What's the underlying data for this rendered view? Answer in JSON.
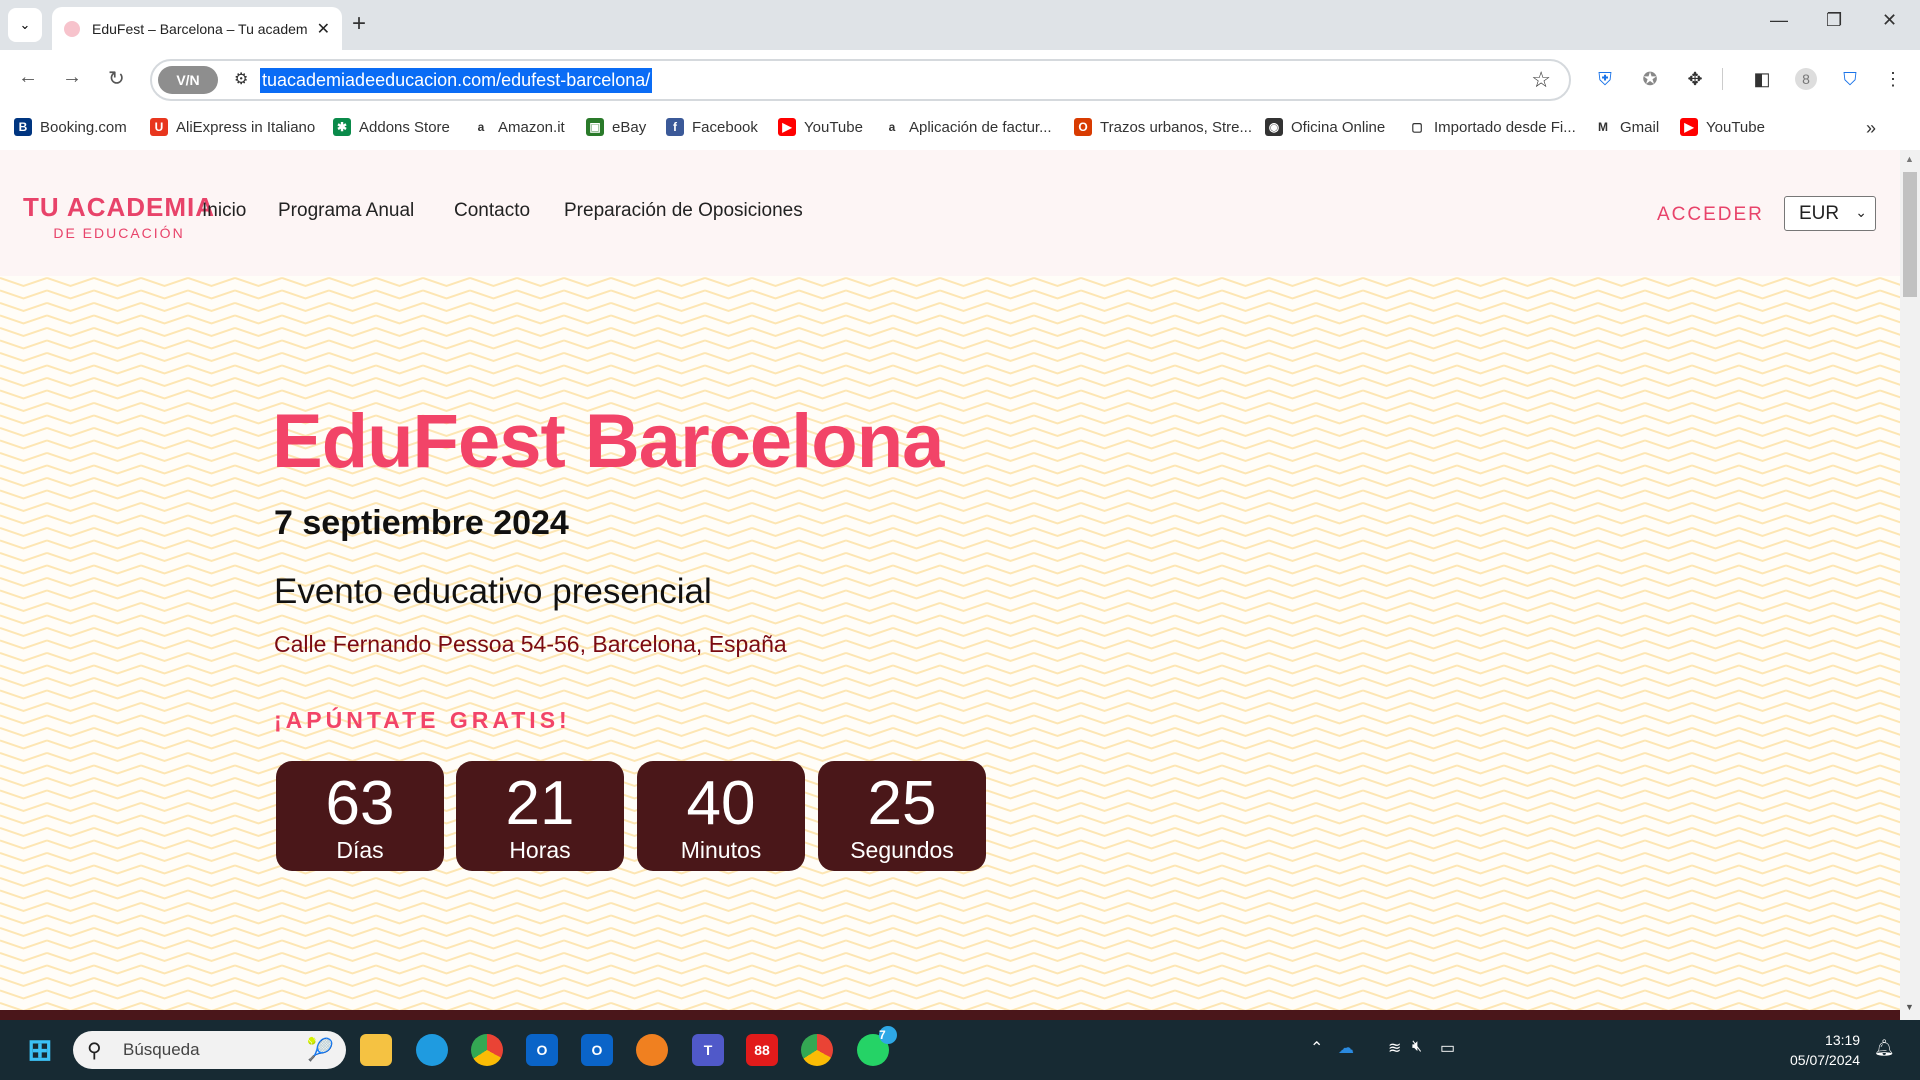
{
  "browser": {
    "tab_title": "EduFest – Barcelona – Tu academia de educación",
    "url": "tuacademiadeeducacion.com/edufest-barcelona/",
    "vpn_label": "V/N",
    "bookmarks": [
      {
        "label": "Booking.com",
        "color": "#003580",
        "glyph": "B"
      },
      {
        "label": "AliExpress in Italiano",
        "color": "#e8361e",
        "glyph": "U"
      },
      {
        "label": "Addons Store",
        "color": "#0a8a4a",
        "glyph": "✱"
      },
      {
        "label": "Amazon.it",
        "color": "#ffffff",
        "glyph": "a"
      },
      {
        "label": "eBay",
        "color": "#2a7a2a",
        "glyph": "▣"
      },
      {
        "label": "Facebook",
        "color": "#3b5998",
        "glyph": "f"
      },
      {
        "label": "YouTube",
        "color": "#ff0000",
        "glyph": "▶"
      },
      {
        "label": "Aplicación de factur...",
        "color": "#ffffff",
        "glyph": "a"
      },
      {
        "label": "Trazos urbanos, Stre...",
        "color": "#d83b01",
        "glyph": "O"
      },
      {
        "label": "Oficina Online",
        "color": "#333333",
        "glyph": "◉"
      },
      {
        "label": "Importado desde Fi...",
        "color": "#ffffff",
        "glyph": "▢"
      },
      {
        "label": "Gmail",
        "color": "#ffffff",
        "glyph": "M"
      },
      {
        "label": "YouTube",
        "color": "#ff0000",
        "glyph": "▶"
      }
    ]
  },
  "site": {
    "logo_line1": "TU ACADEMIA",
    "logo_line2": "DE EDUCACIÓN",
    "nav": [
      "Inicio",
      "Programa Anual",
      "Contacto",
      "Preparación de Oposiciones"
    ],
    "login": "ACCEDER",
    "currency": "EUR",
    "accent": "#f24468",
    "dark": "#4a1719"
  },
  "hero": {
    "title": "EduFest Barcelona",
    "date": "7 septiembre 2024",
    "subtitle": "Evento educativo presencial",
    "address": "Calle Fernando Pessoa 54-56, Barcelona, España",
    "cta": "¡APÚNTATE GRATIS!",
    "countdown": [
      {
        "value": "63",
        "unit": "Días"
      },
      {
        "value": "21",
        "unit": "Horas"
      },
      {
        "value": "40",
        "unit": "Minutos"
      },
      {
        "value": "25",
        "unit": "Segundos"
      }
    ]
  },
  "taskbar": {
    "search_placeholder": "Búsqueda",
    "whatsapp_badge": "7",
    "time": "13:19",
    "date": "05/07/2024"
  }
}
